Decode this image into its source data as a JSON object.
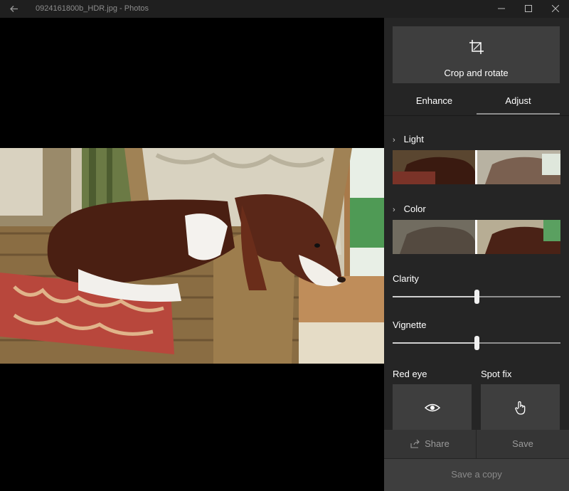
{
  "window": {
    "title": "0924161800b_HDR.jpg - Photos",
    "back_icon": "arrow-left-icon",
    "controls": [
      "minimize-icon",
      "maximize-icon",
      "close-icon"
    ]
  },
  "photo": {
    "description_icon": "photo-image"
  },
  "panel": {
    "crop_label": "Crop and rotate",
    "crop_icon": "crop-icon",
    "tabs": [
      {
        "label": "Enhance",
        "selected": false
      },
      {
        "label": "Adjust",
        "selected": true
      }
    ],
    "light_label": "Light",
    "color_label": "Color",
    "clarity": {
      "label": "Clarity",
      "value": 0.5
    },
    "vignette": {
      "label": "Vignette",
      "value": 0.5
    },
    "red_eye_label": "Red eye",
    "spot_fix_label": "Spot fix",
    "share_label": "Share",
    "save_label": "Save",
    "save_copy_label": "Save a copy"
  },
  "colors": {
    "panel_bg": "#252525",
    "button_bg": "#3e3e3e",
    "titlebar_bg": "#1f1f1f"
  }
}
